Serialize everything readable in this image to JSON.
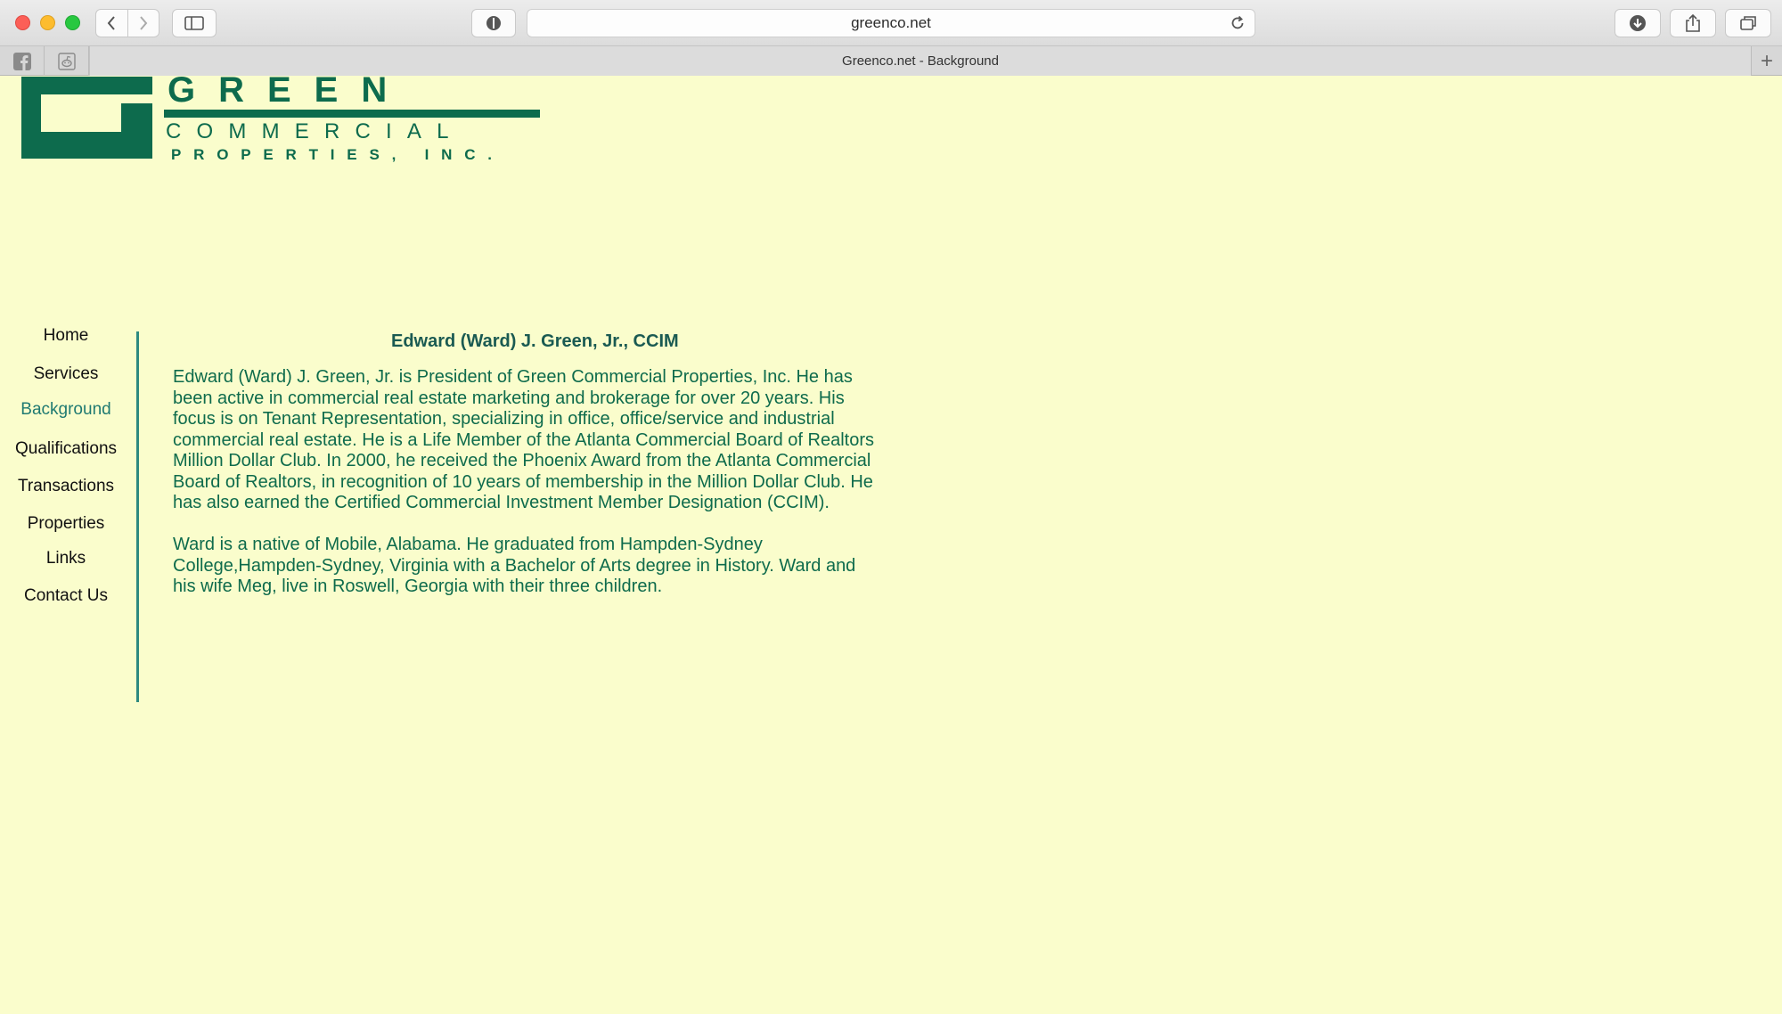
{
  "browser": {
    "url": "greenco.net",
    "tab_title": "Greenco.net - Background",
    "new_tab_label": "+"
  },
  "logo": {
    "text_line1": "GREEN",
    "text_line2": "COMMERCIAL",
    "text_line3": "PROPERTIES, INC.",
    "color": "#0d6b4d"
  },
  "nav": {
    "items": [
      {
        "label": "Home",
        "active": false
      },
      {
        "label": "Services",
        "active": false
      },
      {
        "label": "Background",
        "active": true
      },
      {
        "label": "Qualifications",
        "active": false
      },
      {
        "label": "Transactions",
        "active": false
      },
      {
        "label": "Properties",
        "active": false
      },
      {
        "label": "Links",
        "active": false
      },
      {
        "label": "Contact Us",
        "active": false
      }
    ]
  },
  "content": {
    "heading": "Edward (Ward) J. Green, Jr., CCIM",
    "paragraph1_lines": [
      "Edward (Ward) J. Green, Jr. is President of Green Commercial Properties, Inc. He has",
      "been active in commercial real estate marketing and brokerage for over 20 years. His",
      "focus is on Tenant Representation, specializing in office, office/service and industrial",
      "commercial real estate. He is a Life Member of the Atlanta Commercial Board of Realtors",
      "Million Dollar Club. In 2000, he received the Phoenix Award from the Atlanta Commercial",
      "Board of Realtors, in recognition of 10 years of membership in the Million Dollar Club. He",
      "has also earned the Certified Commercial Investment Member Designation (CCIM)."
    ],
    "paragraph2_lines": [
      "Ward is a native of Mobile, Alabama. He graduated from Hampden-Sydney",
      "College,Hampden-Sydney, Virginia with a Bachelor of Arts degree in History. Ward and",
      "his wife Meg, live in Roswell, Georgia with their three children."
    ]
  },
  "colors": {
    "page_background": "#fafdcc",
    "text_green": "#0e6b4c",
    "nav_active": "#1f7a72",
    "divider": "#2e8a80"
  }
}
